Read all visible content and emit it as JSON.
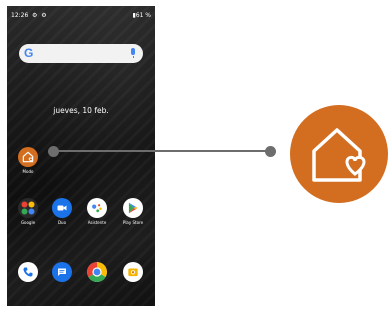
{
  "status_bar": {
    "time": "12:26",
    "dots": "⚙ ⚙",
    "battery": "▮61 %"
  },
  "search": {
    "logo": "G"
  },
  "date": "jueves, 10 feb.",
  "apps": {
    "modo": {
      "label": "Modo",
      "icon": "home-heart-icon",
      "color": "#d36e20"
    },
    "google": {
      "label": "Google",
      "icon": "google-folder-icon"
    },
    "duo": {
      "label": "Duo",
      "icon": "video-camera-icon",
      "color": "#1a73e8"
    },
    "asistente": {
      "label": "Asistente",
      "icon": "assistant-icon"
    },
    "play_store": {
      "label": "Play Store",
      "icon": "play-store-icon"
    },
    "phone": {
      "label": "",
      "icon": "phone-icon",
      "color": "#1a73e8"
    },
    "messages": {
      "label": "",
      "icon": "messages-icon",
      "color": "#1a73e8"
    },
    "chrome": {
      "label": "",
      "icon": "chrome-icon"
    },
    "camera": {
      "label": "",
      "icon": "camera-icon",
      "color": "#f4b400"
    }
  },
  "highlight": {
    "icon": "home-heart-icon",
    "color": "#d36e20"
  }
}
